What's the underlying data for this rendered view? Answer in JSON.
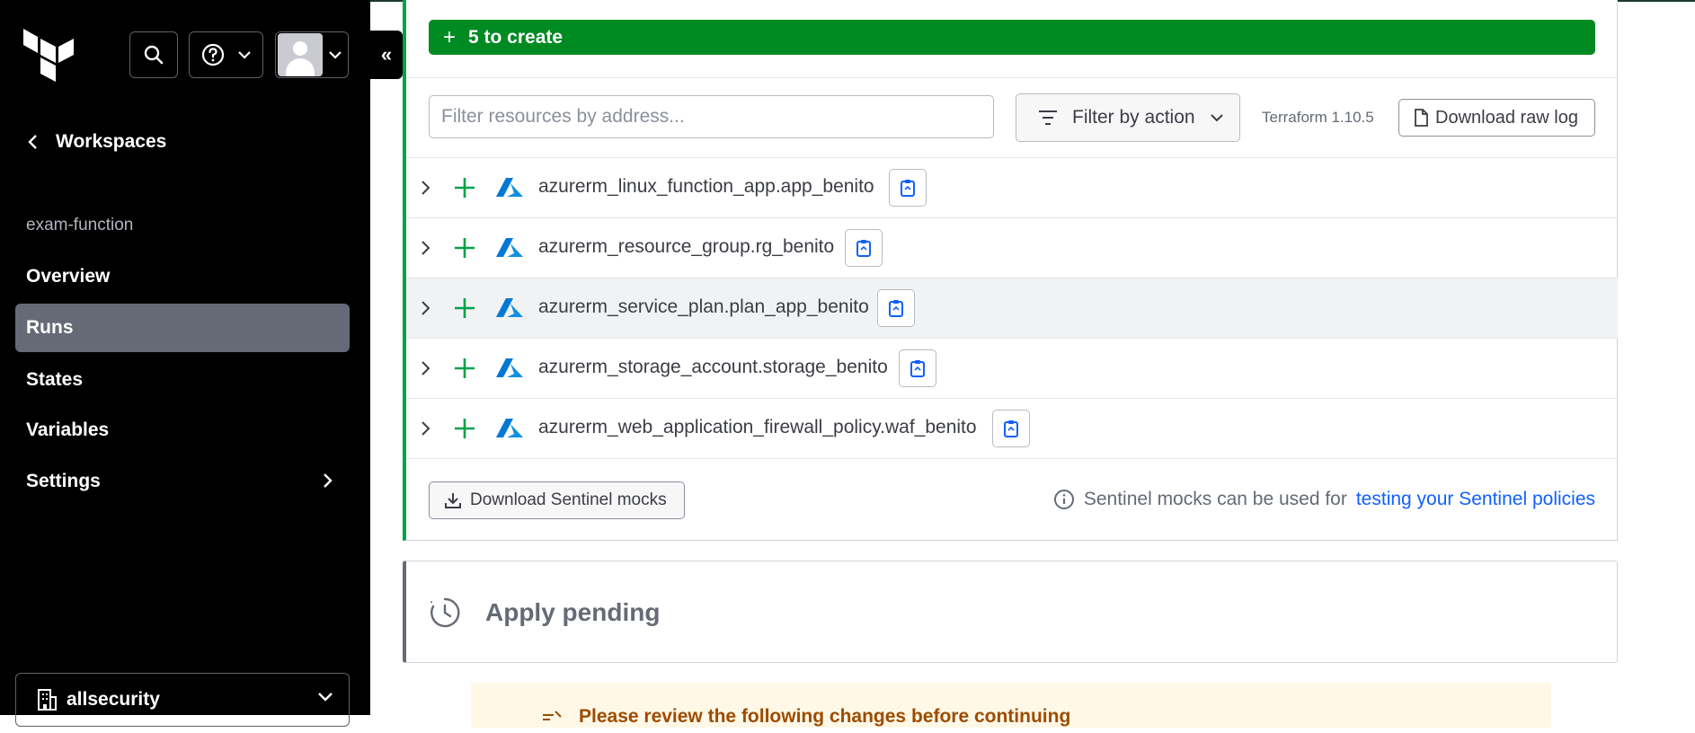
{
  "sidebar": {
    "back_label": "Workspaces",
    "workspace_name": "exam-function",
    "nav": [
      {
        "label": "Overview"
      },
      {
        "label": "Runs"
      },
      {
        "label": "States"
      },
      {
        "label": "Variables"
      },
      {
        "label": "Settings"
      }
    ],
    "active_nav": "Runs",
    "org_name": "allsecurity",
    "collapse_glyph": "«"
  },
  "plan": {
    "create_banner": "5 to create",
    "create_banner_icon": "+",
    "filter_placeholder": "Filter resources by address...",
    "filter_action_label": "Filter by action",
    "terraform_version": "Terraform 1.10.5",
    "download_raw_log": "Download raw log",
    "resources": [
      {
        "address": "azurerm_linux_function_app.app_benito"
      },
      {
        "address": "azurerm_resource_group.rg_benito"
      },
      {
        "address": "azurerm_service_plan.plan_app_benito"
      },
      {
        "address": "azurerm_storage_account.storage_benito"
      },
      {
        "address": "azurerm_web_application_firewall_policy.waf_benito"
      }
    ],
    "download_sentinel": "Download Sentinel mocks",
    "sentinel_note": "Sentinel mocks can be used for",
    "sentinel_link": "testing your Sentinel policies"
  },
  "apply": {
    "title": "Apply pending"
  },
  "notice": {
    "text": "Please review the following changes before continuing"
  },
  "colors": {
    "create_green": "#008a22",
    "plan_accent": "#00a14b",
    "link_blue": "#1060ff",
    "azure_blue": "#0078d4"
  },
  "icons": [
    "terraform-logo",
    "search-icon",
    "help-icon",
    "chevron-down-icon",
    "chevron-left-icon",
    "chevron-right-icon",
    "filter-icon",
    "file-icon",
    "plus-icon",
    "azure-icon",
    "clipboard-icon",
    "download-icon",
    "info-icon",
    "clock-icon",
    "building-icon"
  ]
}
